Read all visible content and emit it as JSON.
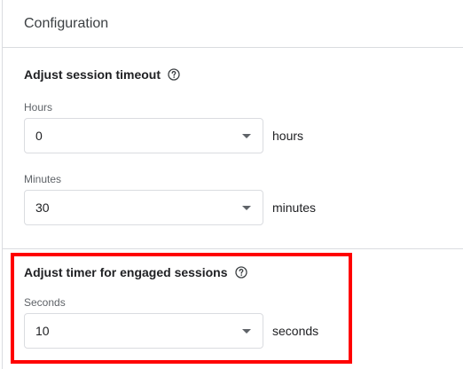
{
  "card": {
    "title": "Configuration"
  },
  "session_timeout": {
    "title": "Adjust session timeout",
    "help_icon": "help-circle-icon",
    "hours": {
      "label": "Hours",
      "value": "0",
      "unit": "hours"
    },
    "minutes": {
      "label": "Minutes",
      "value": "30",
      "unit": "minutes"
    }
  },
  "engaged_timer": {
    "title": "Adjust timer for engaged sessions",
    "help_icon": "help-circle-icon",
    "seconds": {
      "label": "Seconds",
      "value": "10",
      "unit": "seconds"
    }
  },
  "colors": {
    "highlight": "#ff0000",
    "border": "#dadce0",
    "text": "#202124",
    "label": "#5f6368"
  }
}
